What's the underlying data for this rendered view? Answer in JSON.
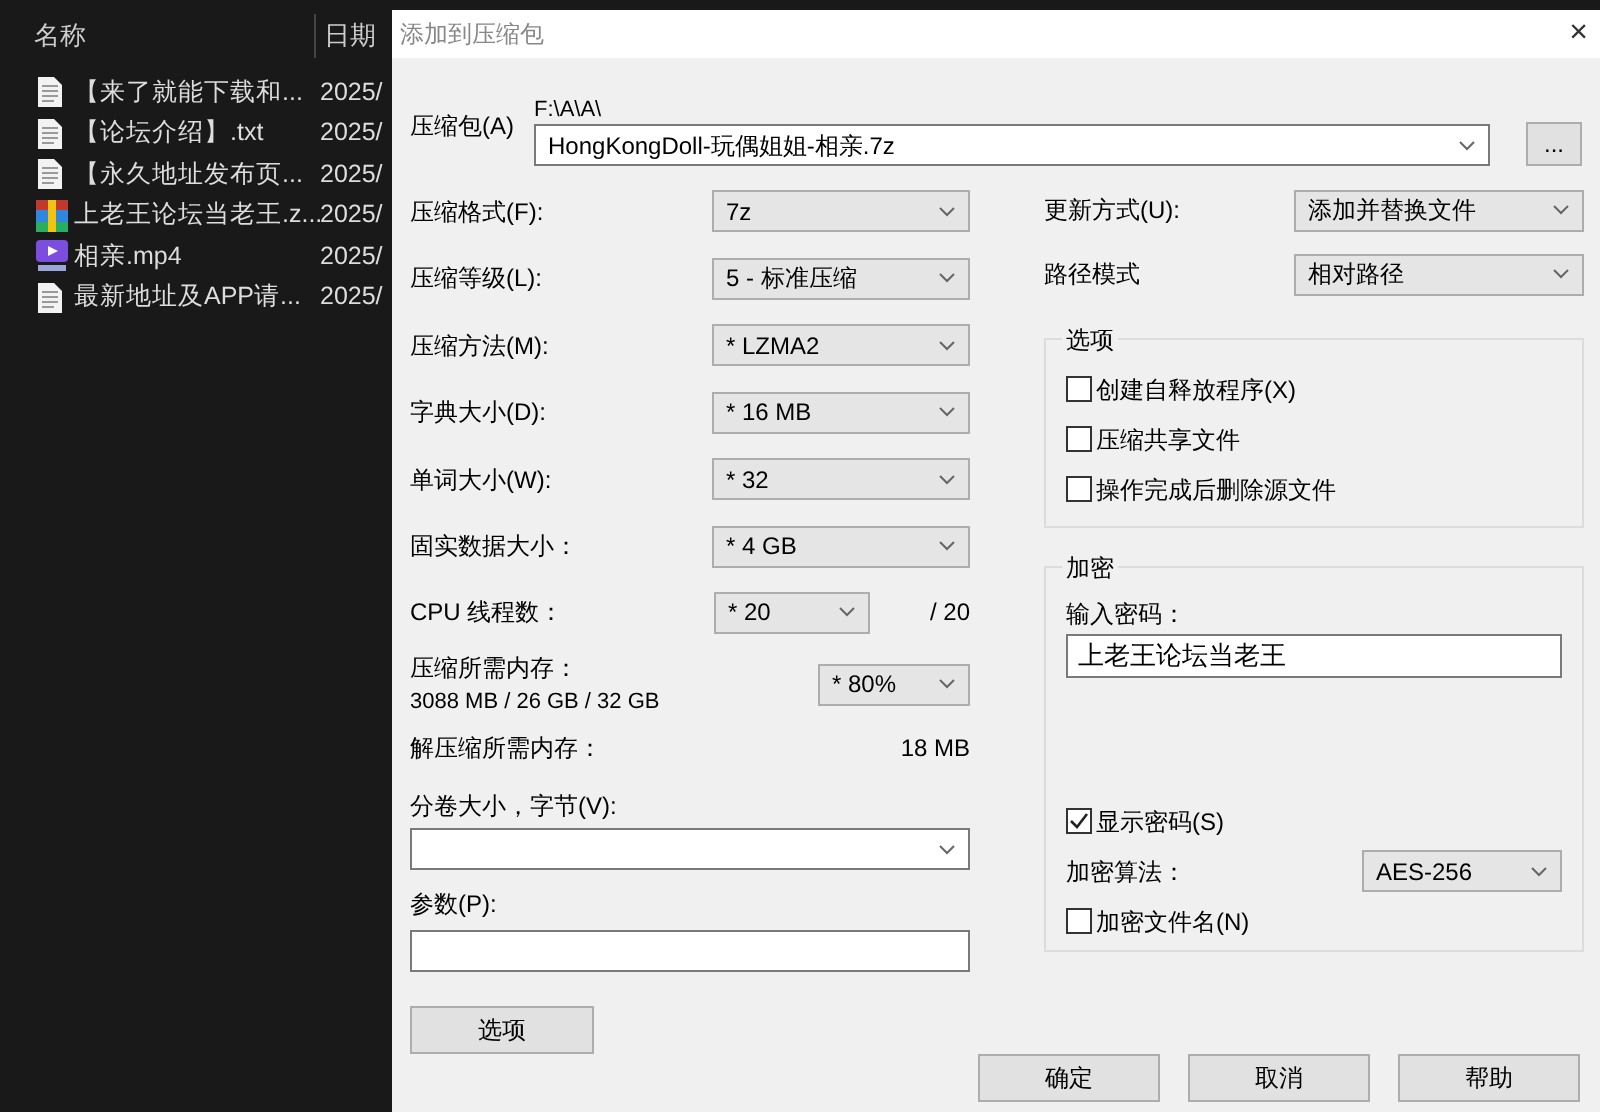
{
  "explorer": {
    "columns": [
      "名称",
      "日期"
    ],
    "files": [
      {
        "name": "【来了就能下载和...",
        "date": "2025/",
        "kind": "text"
      },
      {
        "name": "【论坛介绍】.txt",
        "date": "2025/",
        "kind": "text"
      },
      {
        "name": "【永久地址发布页...",
        "date": "2025/",
        "kind": "text"
      },
      {
        "name": "上老王论坛当老王.z...",
        "date": "2025/",
        "kind": "archive"
      },
      {
        "name": "相亲.mp4",
        "date": "2025/",
        "kind": "video"
      },
      {
        "name": "最新地址及APP请...",
        "date": "2025/",
        "kind": "text"
      }
    ]
  },
  "dialog": {
    "title": "添加到压缩包",
    "close": "×",
    "archive": {
      "label": "压缩包(A)",
      "path": "F:\\A\\A\\",
      "value": "HongKongDoll-玩偶姐姐-相亲.7z",
      "browse": "..."
    },
    "settings": [
      {
        "label": "压缩格式(F):",
        "value": "7z"
      },
      {
        "label": "压缩等级(L):",
        "value": "5 - 标准压缩"
      },
      {
        "label": "压缩方法(M):",
        "value": "* LZMA2"
      },
      {
        "label": "字典大小(D):",
        "value": "* 16 MB"
      },
      {
        "label": "单词大小(W):",
        "value": "* 32"
      },
      {
        "label": "固实数据大小：",
        "value": "* 4 GB"
      }
    ],
    "cpu": {
      "label": "CPU 线程数：",
      "value": "* 20",
      "total": "/ 20"
    },
    "memory": {
      "label": "压缩所需内存：",
      "usage": "3088 MB / 26 GB / 32 GB",
      "value": "* 80%"
    },
    "decompress": {
      "label": "解压缩所需内存：",
      "value": "18 MB"
    },
    "volume": {
      "label": "分卷大小，字节(V):"
    },
    "parameters": {
      "label": "参数(P):"
    },
    "options_button": "选项",
    "update": {
      "label": "更新方式(U):",
      "value": "添加并替换文件"
    },
    "path_mode": {
      "label": "路径模式",
      "value": "相对路径"
    },
    "options": {
      "title": "选项",
      "items": [
        {
          "label": "创建自释放程序(X)",
          "checked": false
        },
        {
          "label": "压缩共享文件",
          "checked": false
        },
        {
          "label": "操作完成后删除源文件",
          "checked": false
        }
      ]
    },
    "encryption": {
      "title": "加密",
      "password_label": "输入密码：",
      "password": "上老王论坛当老王",
      "show_password": {
        "label": "显示密码(S)",
        "checked": true
      },
      "method_label": "加密算法：",
      "method": "AES-256",
      "encrypt_names": {
        "label": "加密文件名(N)",
        "checked": false
      }
    },
    "buttons": [
      "确定",
      "取消",
      "帮助"
    ]
  }
}
